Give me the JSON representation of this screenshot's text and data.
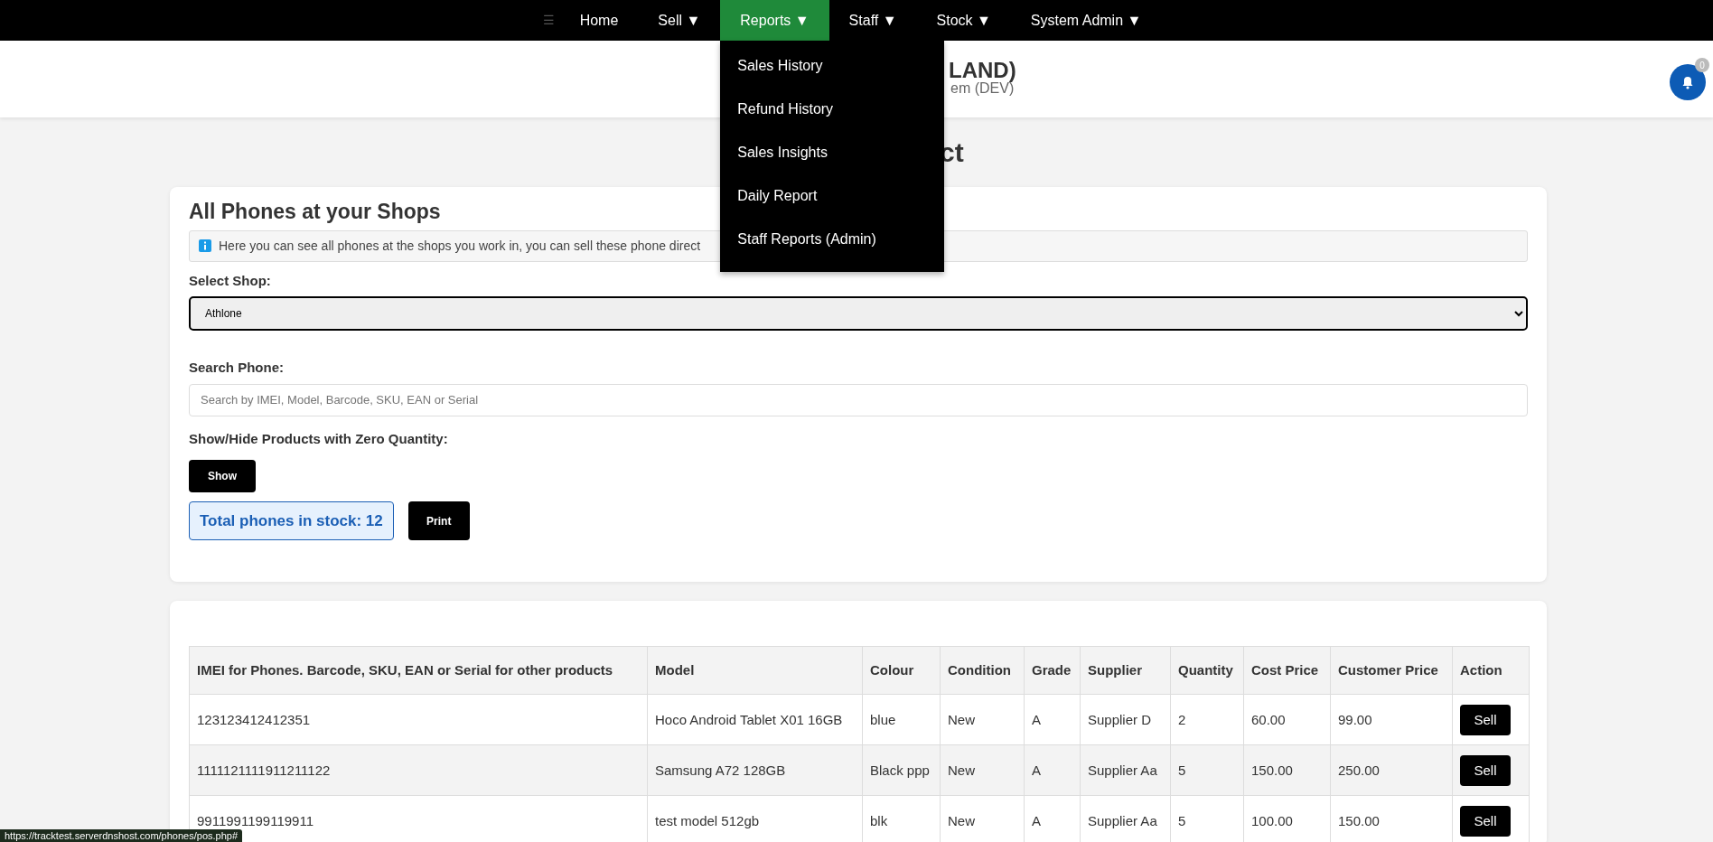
{
  "nav": {
    "menu_icon": "☰",
    "items": [
      {
        "label": "Home",
        "selected": false
      },
      {
        "label": "Sell ▼",
        "selected": false
      },
      {
        "label": "Reports ▼",
        "selected": true,
        "menu": [
          "Sales History",
          "Refund History",
          "Sales Insights",
          "Daily Report",
          "Staff Reports (Admin)"
        ]
      },
      {
        "label": "Staff ▼",
        "selected": false
      },
      {
        "label": "Stock ▼",
        "selected": false
      },
      {
        "label": "System Admin ▼",
        "selected": false
      }
    ]
  },
  "header": {
    "title": "LAND)",
    "subtitle": "em (DEV)",
    "notifications": "0"
  },
  "page_title": "ct",
  "stock_card": {
    "title": "All Phones at your Shops",
    "info": "Here you can see all phones at the shops you work in, you can sell these phone direct",
    "shop_label": "Select Shop:",
    "shop_value": "Athlone",
    "search_label": "Search Phone:",
    "search_placeholder": "Search by IMEI, Model, Barcode, SKU, EAN or Serial",
    "zero_label": "Show/Hide Products with Zero Quantity:",
    "zero_button": "Show",
    "total": "Total phones in stock: 12",
    "print_button": "Print"
  },
  "table": {
    "columns": [
      "IMEI for Phones. Barcode, SKU, EAN or Serial for other products",
      "Model",
      "Colour",
      "Condition",
      "Grade",
      "Supplier",
      "Quantity",
      "Cost Price",
      "Customer Price",
      "Action"
    ],
    "rows": [
      {
        "cells": [
          "123123412412351",
          "Hoco Android Tablet X01 16GB",
          "blue",
          "New",
          "A",
          "Supplier D",
          "2",
          "60.00",
          "99.00"
        ],
        "action": "Sell"
      },
      {
        "cells": [
          "1111121111911211122",
          "Samsung A72 128GB",
          "Black ppp",
          "New",
          "A",
          "Supplier Aa",
          "5",
          "150.00",
          "250.00"
        ],
        "action": "Sell"
      },
      {
        "cells": [
          "9911991199119911",
          "test model 512gb",
          "blk",
          "New",
          "A",
          "Supplier Aa",
          "5",
          "100.00",
          "150.00"
        ],
        "action": "Sell"
      }
    ]
  },
  "status_bar": "https://tracktest.serverdnshost.com/phones/pos.php#"
}
